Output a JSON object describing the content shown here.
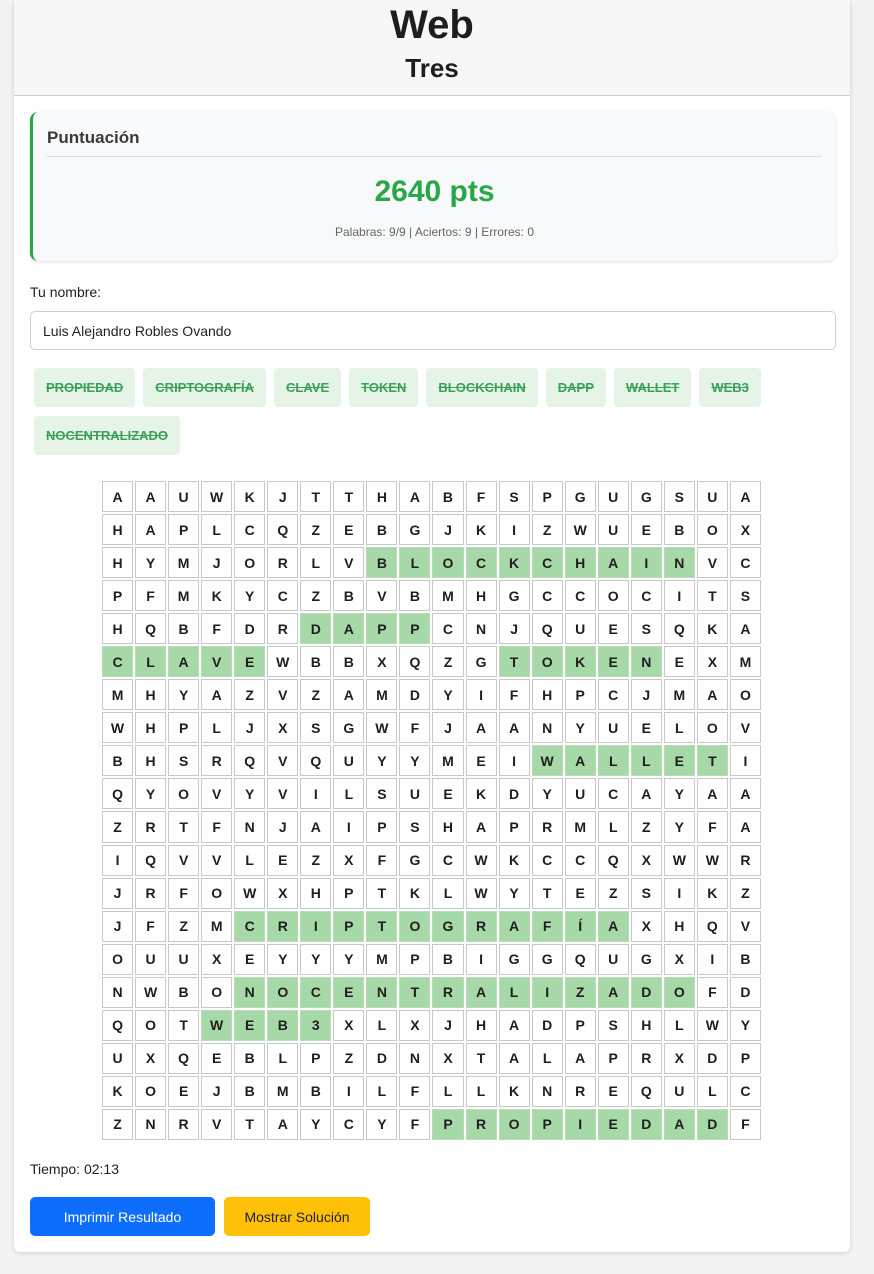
{
  "header": {
    "title": "Web",
    "subtitle": "Tres"
  },
  "score": {
    "heading": "Puntuación",
    "value": "2640 pts",
    "details": "Palabras: 9/9 | Aciertos: 9 | Errores: 0"
  },
  "name": {
    "label": "Tu nombre:",
    "value": "Luis Alejandro Robles Ovando"
  },
  "words": [
    "PROPIEDAD",
    "CRIPTOGRAFÍA",
    "CLAVE",
    "TOKEN",
    "BLOCKCHAIN",
    "DAPP",
    "WALLET",
    "WEB3",
    "NOCENTRALIZADO"
  ],
  "grid": [
    "AAUWKJTTHABFSPGUGSUA",
    "HAPLCQZEBGJKIZWUEBOX",
    "HYMJORLVBLOCKCHAINVC",
    "PFMKYCZBVBMHGCCOCITS",
    "HQBFDRDAPPCNJQUESQKA",
    "CLAVEWBBXQZGTOKENEXM",
    "MHYAZVZAMDYIFHPCJMAO",
    "WHPLJXSGWFJAANYUELOV",
    "BHSRQVQUYYMEIWALLETI",
    "QYOVYVILSUEKDYUCAYAA",
    "ZRTFNJAIPSHAPRMLZYFA",
    "IQVVLEZXFGCWKCCQXWWR",
    "JRFOWXHPTKLWYTEZSIKZ",
    "JFZMCRIPTOGRAFÍAXHQV",
    "OUUXEYYYMPBIGGQUGXIB",
    "NWBONOCENTRALIZADOFD",
    "QOTWEB3XLXJHADPSHLWY",
    "UXQEBLPZDNXTALAPRXDP",
    "KOEJBMBILFLLKNREQULC",
    "ZNRVTAYCYFPROPIEDADF"
  ],
  "found_cells": [
    [
      2,
      8
    ],
    [
      2,
      9
    ],
    [
      2,
      10
    ],
    [
      2,
      11
    ],
    [
      2,
      12
    ],
    [
      2,
      13
    ],
    [
      2,
      14
    ],
    [
      2,
      15
    ],
    [
      2,
      16
    ],
    [
      2,
      17
    ],
    [
      4,
      6
    ],
    [
      4,
      7
    ],
    [
      4,
      8
    ],
    [
      4,
      9
    ],
    [
      5,
      0
    ],
    [
      5,
      1
    ],
    [
      5,
      2
    ],
    [
      5,
      3
    ],
    [
      5,
      4
    ],
    [
      5,
      12
    ],
    [
      5,
      13
    ],
    [
      5,
      14
    ],
    [
      5,
      15
    ],
    [
      5,
      16
    ],
    [
      8,
      13
    ],
    [
      8,
      14
    ],
    [
      8,
      15
    ],
    [
      8,
      16
    ],
    [
      8,
      17
    ],
    [
      8,
      18
    ],
    [
      13,
      4
    ],
    [
      13,
      5
    ],
    [
      13,
      6
    ],
    [
      13,
      7
    ],
    [
      13,
      8
    ],
    [
      13,
      9
    ],
    [
      13,
      10
    ],
    [
      13,
      11
    ],
    [
      13,
      12
    ],
    [
      13,
      13
    ],
    [
      13,
      14
    ],
    [
      13,
      15
    ],
    [
      15,
      4
    ],
    [
      15,
      5
    ],
    [
      15,
      6
    ],
    [
      15,
      7
    ],
    [
      15,
      8
    ],
    [
      15,
      9
    ],
    [
      15,
      10
    ],
    [
      15,
      11
    ],
    [
      15,
      12
    ],
    [
      15,
      13
    ],
    [
      15,
      14
    ],
    [
      15,
      15
    ],
    [
      15,
      16
    ],
    [
      15,
      17
    ],
    [
      16,
      3
    ],
    [
      16,
      4
    ],
    [
      16,
      5
    ],
    [
      16,
      6
    ],
    [
      19,
      10
    ],
    [
      19,
      11
    ],
    [
      19,
      12
    ],
    [
      19,
      13
    ],
    [
      19,
      14
    ],
    [
      19,
      15
    ],
    [
      19,
      16
    ],
    [
      19,
      17
    ],
    [
      19,
      18
    ]
  ],
  "timer": "Tiempo: 02:13",
  "buttons": {
    "print": "Imprimir Resultado",
    "solution": "Mostrar Solución"
  },
  "colors": {
    "accent_green": "#28a745",
    "found_cell": "#a7d8a8",
    "primary_blue": "#0d6efd",
    "warning_yellow": "#ffc107"
  }
}
